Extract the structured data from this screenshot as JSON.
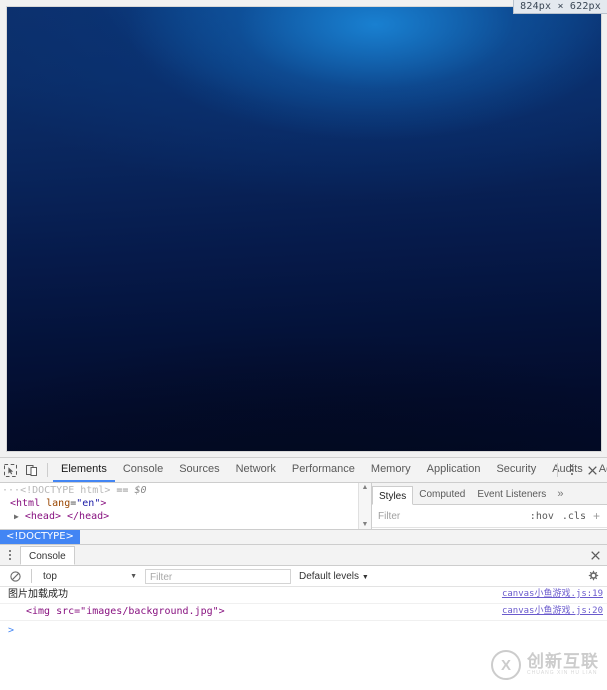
{
  "viewport": {
    "size_badge": "824px × 622px",
    "background_gradient": {
      "top": "#0d2f6b",
      "highlight": "#1a84d5",
      "bottom": "#020a26"
    }
  },
  "devtools": {
    "toolbar": {
      "inspect_icon": "inspect-cursor-icon",
      "device_icon": "device-toolbar-icon",
      "tabs": [
        {
          "label": "Elements",
          "selected": true
        },
        {
          "label": "Console",
          "selected": false
        },
        {
          "label": "Sources",
          "selected": false
        },
        {
          "label": "Network",
          "selected": false
        },
        {
          "label": "Performance",
          "selected": false
        },
        {
          "label": "Memory",
          "selected": false
        },
        {
          "label": "Application",
          "selected": false
        },
        {
          "label": "Security",
          "selected": false
        },
        {
          "label": "Audits",
          "selected": false
        },
        {
          "label": "Adblock Plus",
          "selected": false
        }
      ],
      "more_icon": "kebab-menu-icon",
      "close_icon": "close-icon"
    },
    "elements": {
      "dom": {
        "line1_ellipsis": "···",
        "line1_doctype": "<!DOCTYPE html>",
        "line1_selected": "== $0",
        "line2_open": "<html",
        "line2_attr": "lang",
        "line2_eq": "=",
        "line2_value": "\"en\"",
        "line2_close": ">",
        "line3_triangle": "▶",
        "line3_head": "<head>",
        "line3_headend": "</head>"
      },
      "scroll_up": "▲",
      "scroll_down": "▼",
      "breadcrumb": "<!DOCTYPE>"
    },
    "styles": {
      "tabs": [
        {
          "label": "Styles",
          "selected": true
        },
        {
          "label": "Computed",
          "selected": false
        },
        {
          "label": "Event Listeners",
          "selected": false
        }
      ],
      "overflow": "»",
      "filter_placeholder": "Filter",
      "hov": ":hov",
      "cls": ".cls",
      "add": "+"
    },
    "drawer": {
      "menu_icon": "kebab-menu-icon",
      "tab_label": "Console",
      "close_icon": "close-icon",
      "console_bar": {
        "clear_icon": "clear-console-icon",
        "context": "top",
        "context_arrow": "▼",
        "filter_placeholder": "Filter",
        "levels": "Default levels",
        "levels_arrow": "▼",
        "settings_icon": "gear-icon"
      },
      "messages": [
        {
          "text": "图片加载成功",
          "source": "canvas小鱼游戏.js:19",
          "indented": false,
          "code": false
        },
        {
          "text": "<img src=\"images/background.jpg\">",
          "source": "canvas小鱼游戏.js:20",
          "indented": true,
          "code": true
        }
      ],
      "prompt": ">"
    }
  },
  "watermark": {
    "mark": "X",
    "chinese": "创新互联",
    "pinyin": "CHUANG XIN HU LIAN"
  }
}
